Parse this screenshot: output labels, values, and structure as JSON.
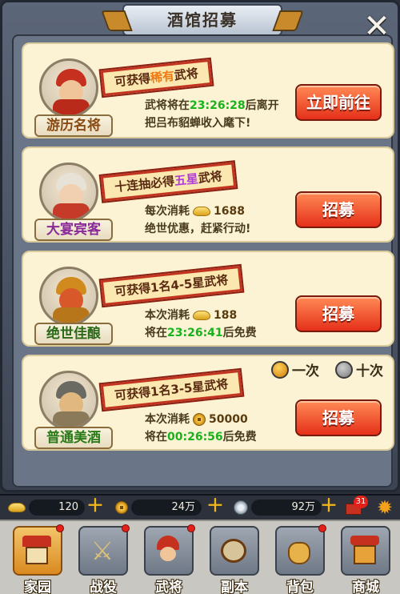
{
  "window": {
    "title": "酒馆招募"
  },
  "cards": [
    {
      "name": "游历名将",
      "ribbon_prefix": "可获得",
      "ribbon_highlight": "稀有",
      "ribbon_suffix": "武将",
      "line1_prefix": "武将将在",
      "line1_time": "23:26:28",
      "line1_suffix": "后离开",
      "line2": "把吕布貂蝉收入麾下!",
      "button": "立即前往"
    },
    {
      "name": "大宴宾客",
      "ribbon_prefix": "十连抽必得",
      "ribbon_highlight": "五星",
      "ribbon_suffix": "武将",
      "cost_label": "每次消耗",
      "cost_value": "1688",
      "line2": "绝世优惠，赶紧行动!",
      "button": "招募"
    },
    {
      "name": "绝世佳酿",
      "ribbon": "可获得1名4-5星武将",
      "cost_label": "本次消耗",
      "cost_value": "188",
      "timer_prefix": "将在",
      "timer": "23:26:41",
      "timer_suffix": "后免费",
      "button": "招募"
    },
    {
      "name": "普通美酒",
      "ribbon": "可获得1名3-5星武将",
      "cost_label": "本次消耗",
      "cost_value": "50000",
      "timer_prefix": "将在",
      "timer": "00:26:56",
      "timer_suffix": "后免费",
      "button": "招募",
      "option_once": "一次",
      "option_ten": "十次"
    }
  ],
  "resources": {
    "ingot": "120",
    "copper": "24万",
    "silver": "92万",
    "badge": "31"
  },
  "nav": [
    "家园",
    "战役",
    "武将",
    "副本",
    "背包",
    "商城"
  ],
  "colors": {
    "button_red": "#e5301a",
    "timer_green": "#17b21c",
    "card_bg": "#fbf3d4"
  }
}
